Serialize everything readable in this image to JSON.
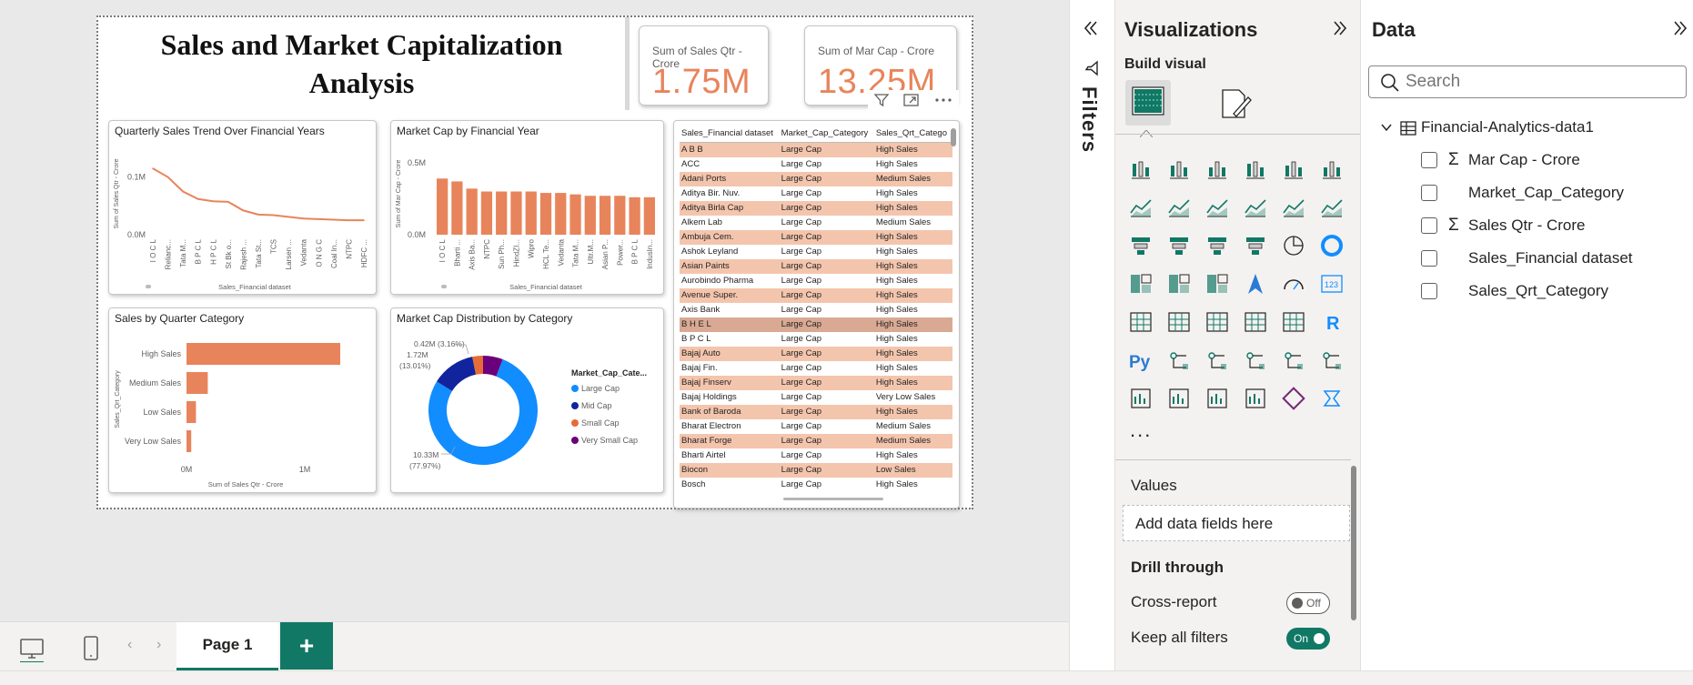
{
  "report": {
    "title": "Sales and Market Capitalization Analysis",
    "cards": [
      {
        "label": "Sum of Sales Qtr - Crore",
        "value": "1.75M"
      },
      {
        "label": "Sum of Mar Cap - Crore",
        "value": "13.25M"
      }
    ],
    "accent": "#e8845b"
  },
  "visuals": {
    "line": {
      "title": "Quarterly Sales Trend Over Financial Years",
      "xlabel": "Sales_Financial dataset",
      "ylabel": "Sum of Sales Qtr - Crore",
      "ticks": [
        "0.1M",
        "0.0M"
      ]
    },
    "bar": {
      "title": "Market Cap by Financial Year",
      "xlabel": "Sales_Financial dataset",
      "ylabel": "Sum of Mar Cap - Crore",
      "ticks": [
        "0.5M",
        "0.0M"
      ]
    },
    "hbar": {
      "title": "Sales by Quarter Category",
      "xlabel": "Sum of Sales Qtr - Crore",
      "ylabel": "Sales_Qrt_Category",
      "ticks": [
        "0M",
        "1M"
      ]
    },
    "donut": {
      "title": "Market Cap Distribution by Category",
      "legend_title": "Market_Cap_Cate...",
      "labels": [
        "0.42M (3.16%)",
        "1.72M",
        "(13.01%)",
        "10.33M",
        "(77.97%)"
      ]
    }
  },
  "chart_data": [
    {
      "type": "line",
      "title": "Quarterly Sales Trend Over Financial Years",
      "xlabel": "Sales_Financial dataset",
      "ylabel": "Sum of Sales Qtr - Crore",
      "categories": [
        "I O C L",
        "Relianc...",
        "Tata M...",
        "B P C L",
        "H P C L",
        "St Bk o...",
        "Rajesh ...",
        "Tata St...",
        "TCS",
        "Larsen ...",
        "Vedanta",
        "O N G C",
        "Coal In...",
        "NTPC",
        "HDFC ..."
      ],
      "values": [
        0.115,
        0.1,
        0.075,
        0.062,
        0.058,
        0.057,
        0.042,
        0.035,
        0.034,
        0.031,
        0.028,
        0.027,
        0.026,
        0.025,
        0.025
      ],
      "ylim": [
        0,
        0.15
      ],
      "color": "#e8845b"
    },
    {
      "type": "bar",
      "title": "Market Cap by Financial Year",
      "xlabel": "Sales_Financial dataset",
      "ylabel": "Sum of Mar Cap - Crore",
      "categories": [
        "I O C L",
        "Bharti ...",
        "Axis Ba...",
        "NTPC",
        "Sun Ph...",
        "HindZI...",
        "Wipro",
        "HCL Te...",
        "Vedanta",
        "Tata M...",
        "Ultr.M...",
        "Asian P...",
        "Power...",
        "B P C L",
        "IndusIn..."
      ],
      "values": [
        0.39,
        0.37,
        0.32,
        0.3,
        0.3,
        0.3,
        0.3,
        0.29,
        0.29,
        0.28,
        0.27,
        0.27,
        0.27,
        0.26,
        0.26
      ],
      "ylim": [
        0,
        0.6
      ],
      "color": "#e8845b"
    },
    {
      "type": "bar",
      "orientation": "horizontal",
      "title": "Sales by Quarter Category",
      "xlabel": "Sum of Sales Qtr - Crore",
      "ylabel": "Sales_Qrt_Category",
      "categories": [
        "High Sales",
        "Medium Sales",
        "Low Sales",
        "Very Low Sales"
      ],
      "values": [
        1.3,
        0.18,
        0.08,
        0.04
      ],
      "xlim": [
        0,
        1.5
      ],
      "color": "#e8845b"
    },
    {
      "type": "pie",
      "title": "Market Cap Distribution by Category",
      "legend_title": "Market_Cap_Cate...",
      "categories": [
        "Large Cap",
        "Mid Cap",
        "Small Cap",
        "Very Small Cap"
      ],
      "values": [
        10.33,
        1.72,
        0.42,
        0.78
      ],
      "colors": [
        "#118dff",
        "#12239e",
        "#e66c37",
        "#6b007b"
      ]
    }
  ],
  "table": {
    "headers": [
      "Sales_Financial dataset",
      "Market_Cap_Category",
      "Sales_Qrt_Catego"
    ],
    "rows": [
      [
        "A B B",
        "Large Cap",
        "High Sales"
      ],
      [
        "ACC",
        "Large Cap",
        "High Sales"
      ],
      [
        "Adani Ports",
        "Large Cap",
        "Medium Sales"
      ],
      [
        "Aditya Bir. Nuv.",
        "Large Cap",
        "High Sales"
      ],
      [
        "Aditya Birla Cap",
        "Large Cap",
        "High Sales"
      ],
      [
        "Alkem Lab",
        "Large Cap",
        "Medium Sales"
      ],
      [
        "Ambuja Cem.",
        "Large Cap",
        "High Sales"
      ],
      [
        "Ashok Leyland",
        "Large Cap",
        "High Sales"
      ],
      [
        "Asian Paints",
        "Large Cap",
        "High Sales"
      ],
      [
        "Aurobindo Pharma",
        "Large Cap",
        "High Sales"
      ],
      [
        "Avenue Super.",
        "Large Cap",
        "High Sales"
      ],
      [
        "Axis Bank",
        "Large Cap",
        "High Sales"
      ],
      [
        "B H E L",
        "Large Cap",
        "High Sales"
      ],
      [
        "B P C L",
        "Large Cap",
        "High Sales"
      ],
      [
        "Bajaj Auto",
        "Large Cap",
        "High Sales"
      ],
      [
        "Bajaj Fin.",
        "Large Cap",
        "High Sales"
      ],
      [
        "Bajaj Finserv",
        "Large Cap",
        "High Sales"
      ],
      [
        "Bajaj Holdings",
        "Large Cap",
        "Very Low Sales"
      ],
      [
        "Bank of Baroda",
        "Large Cap",
        "High Sales"
      ],
      [
        "Bharat Electron",
        "Large Cap",
        "Medium Sales"
      ],
      [
        "Bharat Forge",
        "Large Cap",
        "Medium Sales"
      ],
      [
        "Bharti Airtel",
        "Large Cap",
        "High Sales"
      ],
      [
        "Biocon",
        "Large Cap",
        "Low Sales"
      ],
      [
        "Bosch",
        "Large Cap",
        "High Sales"
      ]
    ]
  },
  "bottom": {
    "page_tab": "Page 1",
    "add": "+"
  },
  "filters": {
    "label": "Filters"
  },
  "viz_pane": {
    "title": "Visualizations",
    "build_visual": "Build visual",
    "more": "...",
    "values_label": "Values",
    "add_fields": "Add data fields here",
    "drill_through": "Drill through",
    "cross_report": "Cross-report",
    "cross_report_state": "Off",
    "keep_filters": "Keep all filters",
    "keep_filters_state": "On"
  },
  "data_pane": {
    "title": "Data",
    "search_placeholder": "Search",
    "table_name": "Financial-Analytics-data1",
    "fields": [
      {
        "name": "Mar Cap - Crore",
        "sigma": true
      },
      {
        "name": "Market_Cap_Category",
        "sigma": false
      },
      {
        "name": "Sales Qtr - Crore",
        "sigma": true
      },
      {
        "name": "Sales_Financial dataset",
        "sigma": false
      },
      {
        "name": "Sales_Qrt_Category",
        "sigma": false
      }
    ]
  }
}
